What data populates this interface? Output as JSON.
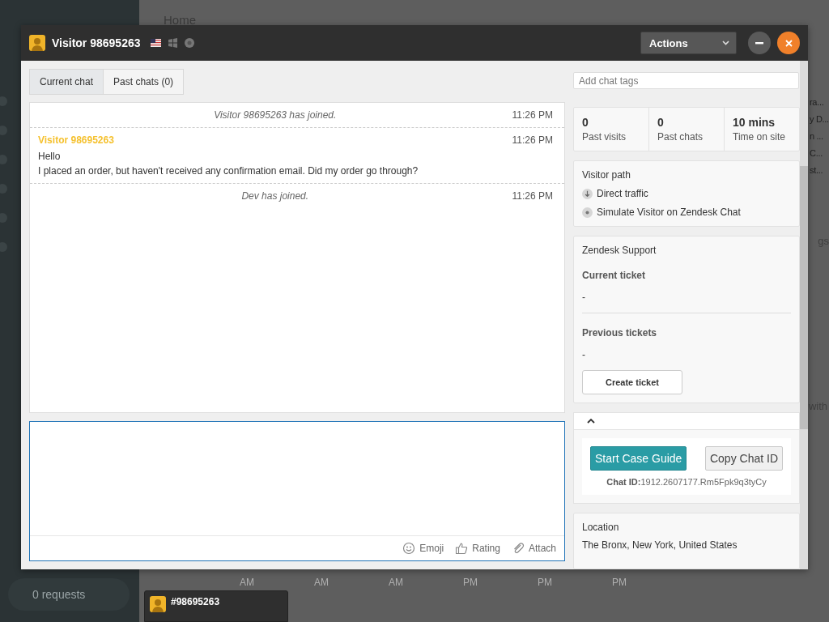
{
  "background": {
    "page_title": "Home",
    "requests": "0 requests",
    "side_list": [
      "ra...",
      "y D...",
      "n ...",
      "C...",
      "st..."
    ],
    "side_texts": [
      "gs",
      "with"
    ],
    "axis_labels": [
      "AM",
      "AM",
      "AM",
      "PM",
      "PM",
      "PM"
    ],
    "chat_tab": {
      "label": "#98695263"
    }
  },
  "window": {
    "title": "Visitor 98695263",
    "actions": "Actions"
  },
  "tabs": [
    {
      "label": "Current chat",
      "selected": true
    },
    {
      "label": "Past chats (0)",
      "selected": false
    }
  ],
  "messages": [
    {
      "kind": "system",
      "text": "Visitor 98695263 has joined.",
      "time": "11:26 PM"
    },
    {
      "kind": "visitor",
      "author": "Visitor 98695263",
      "lines": [
        "Hello",
        "I placed an order, but haven't received any confirmation email. Did my order go through?"
      ],
      "time": "11:26 PM"
    },
    {
      "kind": "system",
      "text": "Dev has joined.",
      "time": "11:26 PM"
    }
  ],
  "composer": {
    "tools": [
      {
        "kind": "emoji",
        "label": "Emoji"
      },
      {
        "kind": "rating",
        "label": "Rating"
      },
      {
        "kind": "attach",
        "label": "Attach"
      }
    ]
  },
  "tags": {
    "placeholder": "Add chat tags"
  },
  "stats": [
    {
      "value": "0",
      "label": "Past visits"
    },
    {
      "value": "0",
      "label": "Past chats"
    },
    {
      "value": "10 mins",
      "label": "Time on site"
    }
  ],
  "visitor_path": {
    "title": "Visitor path",
    "items": [
      {
        "kind": "referrer",
        "text": "Direct traffic"
      },
      {
        "kind": "page",
        "text": "Simulate Visitor on Zendesk Chat"
      }
    ]
  },
  "support": {
    "title": "Zendesk Support",
    "current_label": "Current ticket",
    "current_value": "-",
    "previous_label": "Previous tickets",
    "previous_value": "-",
    "button": "Create ticket"
  },
  "app_panel": {
    "expanded": true,
    "primary_button": "Start Case Guide",
    "secondary_button": "Copy Chat ID",
    "chat_id": "**Chat ID:**1912.2607177.Rm5Fpk9q3tyCy"
  },
  "location": {
    "title": "Location",
    "value": "The Bronx, New York, United States"
  }
}
